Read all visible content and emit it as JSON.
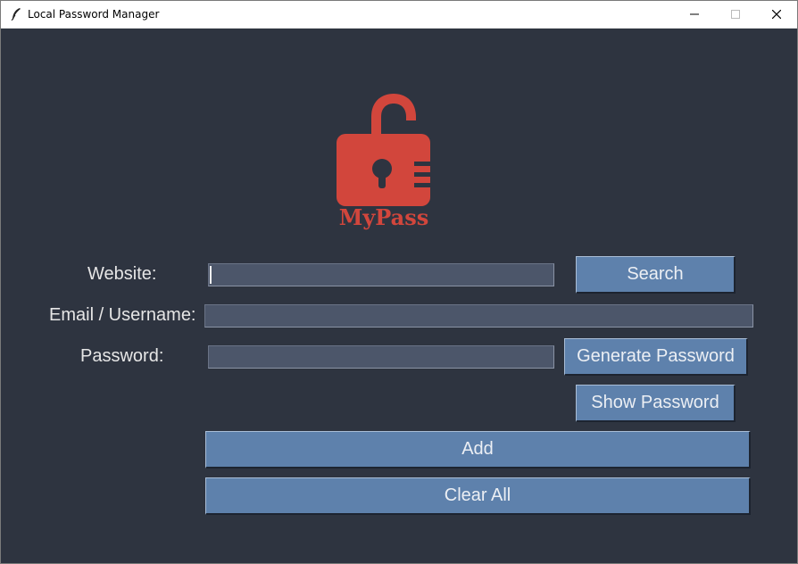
{
  "window": {
    "title": "Local Password Manager"
  },
  "logo": {
    "text": "MyPass",
    "color": "#d2463c"
  },
  "form": {
    "website_label": "Website:",
    "website_value": "",
    "email_label": "Email / Username:",
    "email_value": "",
    "password_label": "Password:",
    "password_value": ""
  },
  "buttons": {
    "search": "Search",
    "generate": "Generate Password",
    "show": "Show Password",
    "add": "Add",
    "clear": "Clear All"
  },
  "colors": {
    "background": "#2e3440",
    "entry": "#4c566a",
    "button": "#5e81ac",
    "text": "#e6e6e6"
  }
}
